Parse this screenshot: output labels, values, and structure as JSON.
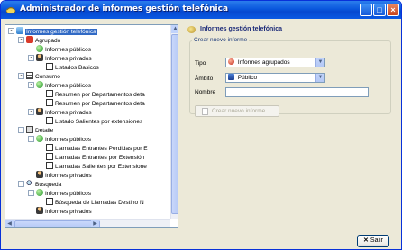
{
  "window": {
    "title": "Administrador de informes gestión telefónica"
  },
  "tree": {
    "items": [
      {
        "label": "Informes gestión telefónica",
        "level": 0,
        "icon": "database-icon",
        "expander": "-",
        "selected": true
      },
      {
        "label": "Agrupado",
        "level": 1,
        "icon": "agrupado-icon",
        "expander": "-"
      },
      {
        "label": "Informes públicos",
        "level": 2,
        "icon": "globe-icon",
        "expander": ""
      },
      {
        "label": "Informes privados",
        "level": 2,
        "icon": "person-icon",
        "expander": "-"
      },
      {
        "label": "Listados Basicos",
        "level": 3,
        "icon": "document-icon",
        "expander": ""
      },
      {
        "label": "Consumo",
        "level": 1,
        "icon": "table-icon",
        "expander": "-"
      },
      {
        "label": "Informes públicos",
        "level": 2,
        "icon": "globe-icon",
        "expander": "-"
      },
      {
        "label": "Resumen por Departamentos deta",
        "level": 3,
        "icon": "document-icon",
        "expander": ""
      },
      {
        "label": "Resumen por Departamentos deta",
        "level": 3,
        "icon": "document-icon",
        "expander": ""
      },
      {
        "label": "Informes privados",
        "level": 2,
        "icon": "person-icon",
        "expander": "-"
      },
      {
        "label": "Listado Salientes por extensiones",
        "level": 3,
        "icon": "document-icon",
        "expander": ""
      },
      {
        "label": "Detalle",
        "level": 1,
        "icon": "detail-icon",
        "expander": "-"
      },
      {
        "label": "Informes públicos",
        "level": 2,
        "icon": "globe-icon",
        "expander": "-"
      },
      {
        "label": "Llamadas Entrantes Perdidas por E",
        "level": 3,
        "icon": "document-icon",
        "expander": ""
      },
      {
        "label": "Llamadas Entrantes por Extensión",
        "level": 3,
        "icon": "document-icon",
        "expander": ""
      },
      {
        "label": "Llamadas Salientes por Extensione",
        "level": 3,
        "icon": "document-icon",
        "expander": ""
      },
      {
        "label": "Informes privados",
        "level": 2,
        "icon": "person-icon",
        "expander": ""
      },
      {
        "label": "Búsqueda",
        "level": 1,
        "icon": "search-icon",
        "expander": "-"
      },
      {
        "label": "Informes públicos",
        "level": 2,
        "icon": "globe-icon",
        "expander": "-"
      },
      {
        "label": "Búsqueda de Llamadas Destino N",
        "level": 3,
        "icon": "document-icon",
        "expander": ""
      },
      {
        "label": "Informes privados",
        "level": 2,
        "icon": "person-icon",
        "expander": ""
      }
    ]
  },
  "panel": {
    "title": "Informes gestión telefónica",
    "group_title": "Crear nuevo informe",
    "tipo_label": "Tipo",
    "tipo_value": "Informes agrupados",
    "ambito_label": "Ámbito",
    "ambito_value": "Público",
    "nombre_label": "Nombre",
    "nombre_value": "",
    "create_button": "Crear nuevo informe"
  },
  "footer": {
    "exit_button": "Salir"
  }
}
